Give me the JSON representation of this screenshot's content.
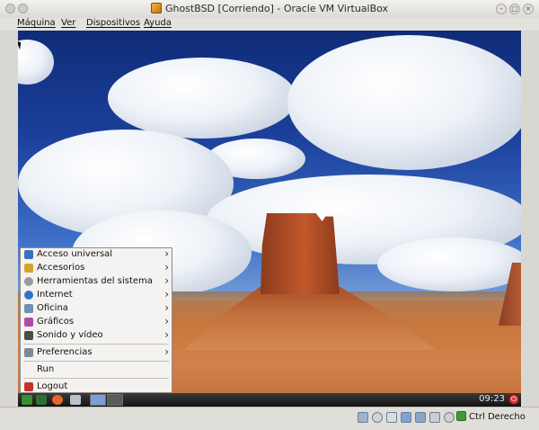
{
  "window": {
    "title": "GhostBSD [Corriendo] - Oracle VM VirtualBox",
    "minimize_glyph": "–",
    "maximize_glyph": "□",
    "close_glyph": "×"
  },
  "menubar": {
    "items": [
      {
        "label": "Máquina"
      },
      {
        "label": "Ver"
      },
      {
        "label": "Dispositivos"
      },
      {
        "label": "Ayuda"
      }
    ]
  },
  "start_menu": {
    "arrow_glyph": "›",
    "items": [
      {
        "label": "Acceso universal",
        "icon": "accessibility-icon",
        "color": "#3a6fc4"
      },
      {
        "label": "Accesorios",
        "icon": "accessories-icon",
        "color": "#d7a42b"
      },
      {
        "label": "Herramientas del sistema",
        "icon": "system-tools-icon",
        "color": "#9a9a9a"
      },
      {
        "label": "Internet",
        "icon": "internet-icon",
        "color": "#2f74c8"
      },
      {
        "label": "Oficina",
        "icon": "office-icon",
        "color": "#6f8fb5"
      },
      {
        "label": "Gráficos",
        "icon": "graphics-icon",
        "color": "#b24aa8"
      },
      {
        "label": "Sonido y vídeo",
        "icon": "sound-video-icon",
        "color": "#4b4b4b"
      },
      {
        "label": "Preferencias",
        "icon": "preferences-icon",
        "color": "#7c8a99"
      },
      {
        "label": "Run",
        "icon": "",
        "color": ""
      },
      {
        "label": "Logout",
        "icon": "logout-icon",
        "color": "#c8302a"
      }
    ]
  },
  "taskbar": {
    "clock": "09:23",
    "power_glyph": "⏻"
  },
  "status": {
    "host_key": "Ctrl Derecho"
  }
}
